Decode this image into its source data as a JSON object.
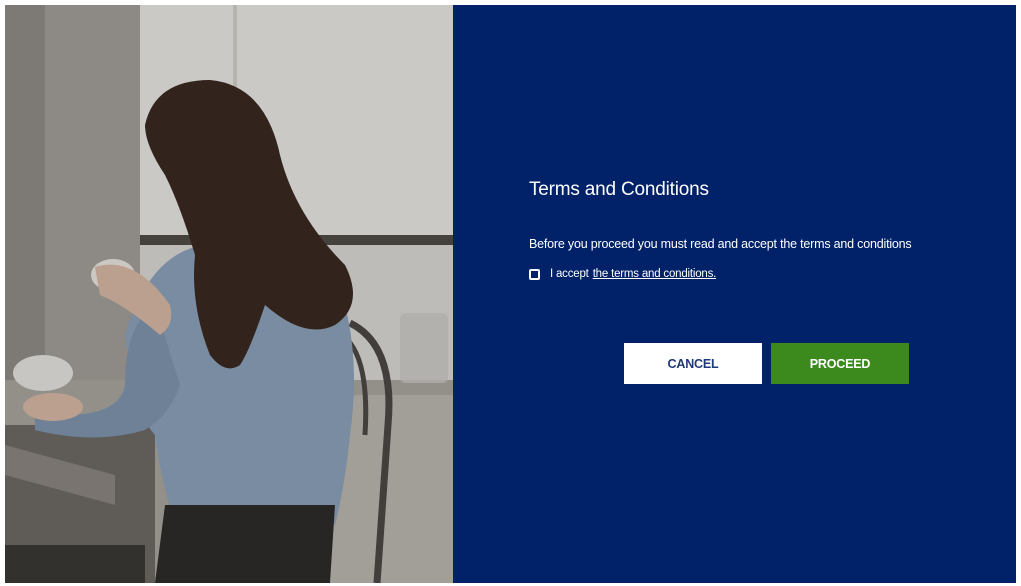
{
  "terms": {
    "title": "Terms and Conditions",
    "intro": "Before you proceed you must read and accept the terms and conditions",
    "accept_prefix": "I accept",
    "accept_link": "the terms and conditions.",
    "checked": false
  },
  "buttons": {
    "cancel": "CANCEL",
    "proceed": "PROCEED"
  },
  "colors": {
    "panel_background": "#012169",
    "proceed_button": "#3c8a1e",
    "cancel_button": "#ffffff"
  }
}
